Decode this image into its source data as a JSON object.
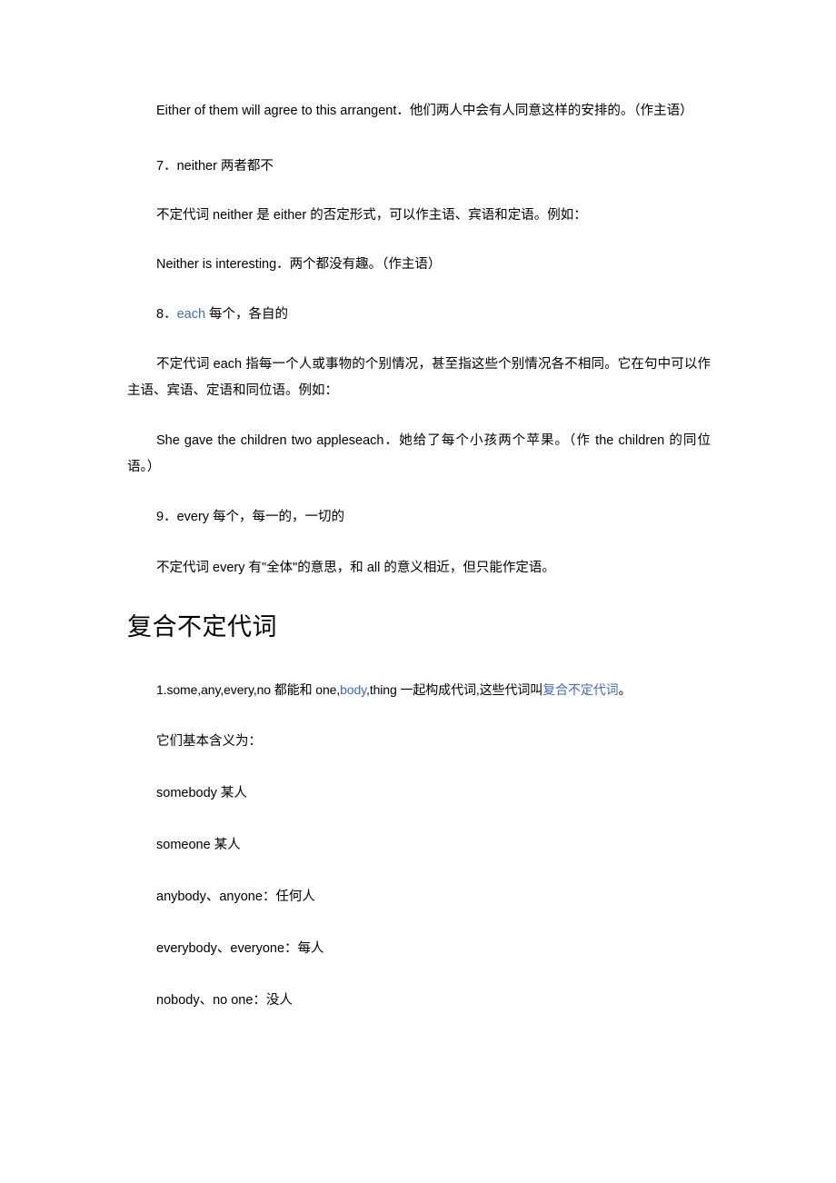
{
  "document": {
    "background_color": "#ffffff",
    "text_color": "#000000",
    "link_color": "#4169c9",
    "blocks": {
      "either_example": "Either of them will agree to this arrangent．他们两人中会有人同意这样的安排的。（作主语）",
      "item7_heading": "7．neither 两者都不",
      "item7_body": "不定代词 neither 是 either 的否定形式，可以作主语、宾语和定语。例如：",
      "neither_example": "Neither is interesting．两个都没有趣。（作主语）",
      "item8_number": "8．",
      "item8_link": "each",
      "item8_heading_rest": " 每个，各自的",
      "item8_body": "不定代词 each 指每一个人或事物的个别情况，甚至指这些个别情况各不相同。它在句中可以作主语、宾语、定语和同位语。例如：",
      "each_example": "She gave the children two appleseach．她给了每个小孩两个苹果。（作 the children 的同位语。）",
      "item9_heading": "9．every 每个，每一的，一切的",
      "item9_body": "不定代词 every 有\"全体\"的意思，和 all 的意义相近，但只能作定语。",
      "section_title": "复合不定代词",
      "compound_intro_part1": "1.some,any,every,no 都能和 one,",
      "compound_intro_link1": "body",
      "compound_intro_part2": ",thing 一起构成代词,这些代词叫",
      "compound_intro_link2": "复合不定代词",
      "compound_intro_part3": "。",
      "meanings_lead": "它们基本含义为："
    },
    "meanings_list": [
      "somebody 某人",
      "someone 某人",
      "anybody、anyone：任何人",
      "everybody、everyone：每人",
      "nobody、no one：没人"
    ]
  }
}
